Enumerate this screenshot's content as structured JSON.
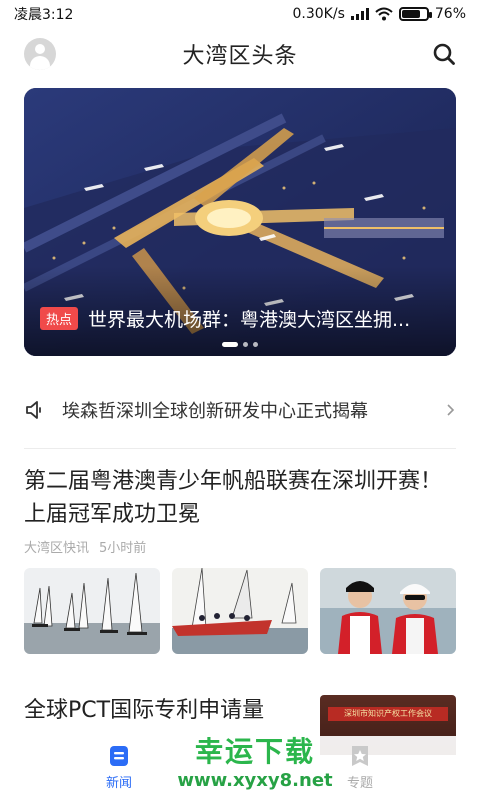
{
  "status_bar": {
    "time": "凌晨3:12",
    "network_speed": "0.30K/s",
    "battery_percent": "76%",
    "battery_level": 0.76
  },
  "header": {
    "title": "大湾区头条",
    "avatar_icon": "user-avatar-icon",
    "search_icon": "search-icon"
  },
  "banner": {
    "badge": "热点",
    "title": "世界最大机场群：粤港澳大湾区坐拥...",
    "slide_count": 3,
    "active_slide": 1
  },
  "notice": {
    "icon": "speaker-icon",
    "text": "埃森哲深圳全球创新研发中心正式揭幕",
    "arrow_icon": "chevron-right-icon"
  },
  "news": [
    {
      "title": "第二届粤港澳青少年帆船联赛在深圳开赛！上届冠军成功卫冕",
      "source": "大湾区快讯",
      "time": "5小时前"
    },
    {
      "title": "全球PCT国际专利申请量",
      "image_caption": "深圳市知识产权工作会议"
    }
  ],
  "watermark": {
    "line1": "幸运下载",
    "line2": "www.xyxy8.net"
  },
  "bottom_nav": {
    "tabs": [
      {
        "label": "新闻",
        "active": true
      },
      {
        "label": "专题",
        "active": false
      }
    ]
  },
  "colors": {
    "accent": "#2b6cf6",
    "hot_badge": "#f04a4a",
    "watermark": "#2bb64c"
  }
}
